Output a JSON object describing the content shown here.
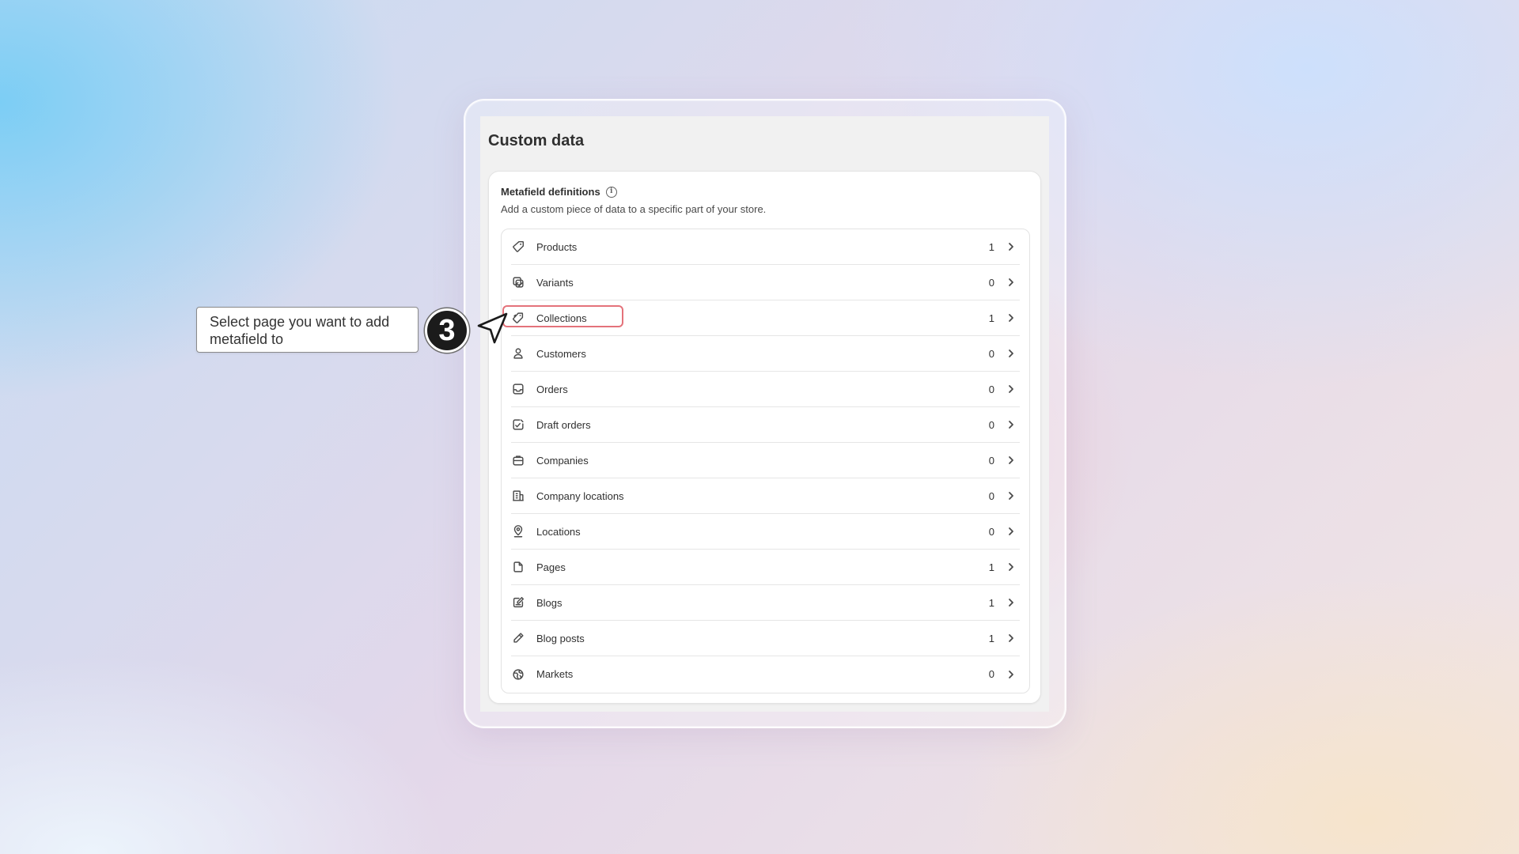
{
  "page": {
    "title": "Custom data"
  },
  "card": {
    "title": "Metafield definitions",
    "description": "Add a custom piece of data to a specific part of your store."
  },
  "items": [
    {
      "label": "Products",
      "count": "1",
      "icon": "tag-icon"
    },
    {
      "label": "Variants",
      "count": "0",
      "icon": "variants-icon"
    },
    {
      "label": "Collections",
      "count": "1",
      "icon": "collection-icon",
      "highlighted": true
    },
    {
      "label": "Customers",
      "count": "0",
      "icon": "person-icon"
    },
    {
      "label": "Orders",
      "count": "0",
      "icon": "inbox-icon"
    },
    {
      "label": "Draft orders",
      "count": "0",
      "icon": "draft-order-icon"
    },
    {
      "label": "Companies",
      "count": "0",
      "icon": "briefcase-icon"
    },
    {
      "label": "Company locations",
      "count": "0",
      "icon": "building-icon"
    },
    {
      "label": "Locations",
      "count": "0",
      "icon": "location-pin-icon"
    },
    {
      "label": "Pages",
      "count": "1",
      "icon": "page-icon"
    },
    {
      "label": "Blogs",
      "count": "1",
      "icon": "blog-icon"
    },
    {
      "label": "Blog posts",
      "count": "1",
      "icon": "pencil-icon"
    },
    {
      "label": "Markets",
      "count": "0",
      "icon": "globe-icon"
    }
  ],
  "annotation": {
    "text": "Select page you want to add metafield to",
    "step": "3",
    "highlight_color": "#e4727a"
  }
}
